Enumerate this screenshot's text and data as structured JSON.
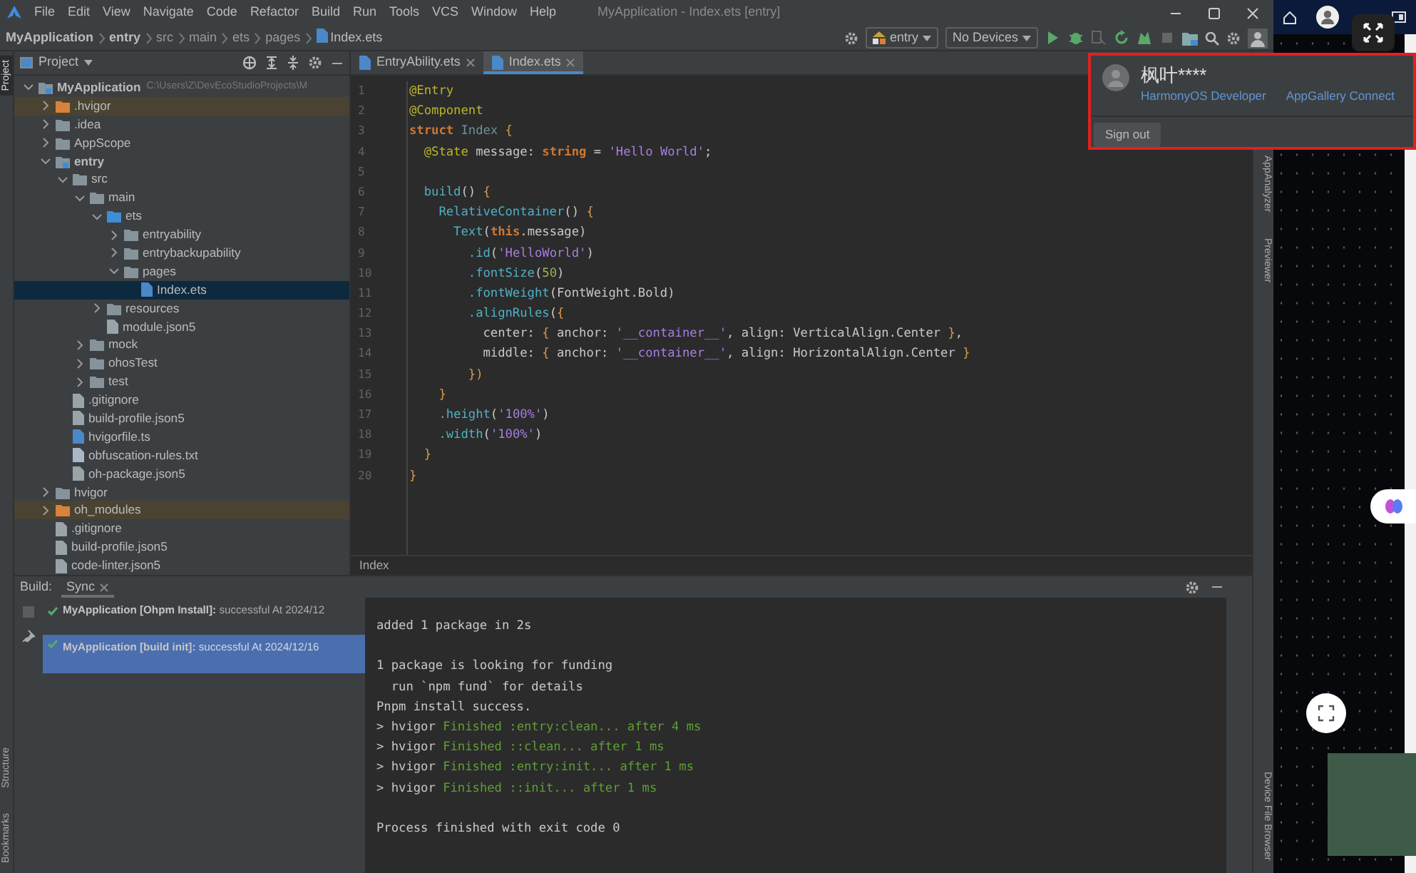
{
  "window": {
    "title": "MyApplication - Index.ets [entry]"
  },
  "menu": [
    "File",
    "Edit",
    "View",
    "Navigate",
    "Code",
    "Refactor",
    "Build",
    "Run",
    "Tools",
    "VCS",
    "Window",
    "Help"
  ],
  "breadcrumb": [
    {
      "kind": "project",
      "label": "MyApplication"
    },
    {
      "kind": "module",
      "label": "entry"
    },
    {
      "kind": "folder",
      "label": "src"
    },
    {
      "kind": "folder",
      "label": "main"
    },
    {
      "kind": "folder",
      "label": "ets"
    },
    {
      "kind": "folder",
      "label": "pages"
    },
    {
      "kind": "file",
      "label": "Index.ets"
    }
  ],
  "toolbar": {
    "configuration": "entry",
    "device": "No Devices",
    "actions": [
      {
        "kind": "run",
        "disabled": false
      },
      {
        "kind": "debug",
        "disabled": false
      },
      {
        "kind": "attach",
        "disabled": true
      },
      {
        "kind": "rerun",
        "disabled": false
      },
      {
        "kind": "profile",
        "disabled": false
      },
      {
        "kind": "stop",
        "disabled": true
      }
    ]
  },
  "tool_windows": {
    "left_top": [
      {
        "label": "Project",
        "selected": true
      }
    ],
    "left_bottom": [
      {
        "label": "Structure",
        "selected": false
      },
      {
        "label": "Bookmarks",
        "selected": false
      }
    ],
    "right_top": [
      {
        "label": "AppAnalyzer",
        "selected": false
      },
      {
        "label": "Previewer",
        "selected": false
      }
    ],
    "right_bottom": [
      {
        "label": "Device File Browser",
        "selected": false
      }
    ]
  },
  "project_panel": {
    "title": "Project",
    "tree": [
      {
        "kind": "module",
        "label": "MyApplication",
        "path": "C:\\Users\\Z\\DevEcoStudioProjects\\M",
        "expanded": true,
        "selected": false,
        "children": [
          {
            "kind": "excluded-folder",
            "label": ".hvigor",
            "expanded": false,
            "selected": false
          },
          {
            "kind": "folder",
            "label": ".idea",
            "expanded": false,
            "selected": false
          },
          {
            "kind": "folder",
            "label": "AppScope",
            "expanded": false,
            "selected": false
          },
          {
            "kind": "module",
            "label": "entry",
            "expanded": true,
            "selected": false,
            "children": [
              {
                "kind": "folder",
                "label": "src",
                "expanded": true,
                "selected": false,
                "children": [
                  {
                    "kind": "folder",
                    "label": "main",
                    "expanded": true,
                    "selected": false,
                    "children": [
                      {
                        "kind": "source-folder",
                        "label": "ets",
                        "expanded": true,
                        "selected": false,
                        "children": [
                          {
                            "kind": "folder",
                            "label": "entryability",
                            "expanded": false,
                            "selected": false
                          },
                          {
                            "kind": "folder",
                            "label": "entrybackupability",
                            "expanded": false,
                            "selected": false
                          },
                          {
                            "kind": "folder",
                            "label": "pages",
                            "expanded": true,
                            "selected": false,
                            "children": [
                              {
                                "kind": "code-file",
                                "label": "Index.ets",
                                "selected": true
                              }
                            ]
                          }
                        ]
                      },
                      {
                        "kind": "folder",
                        "label": "resources",
                        "expanded": false,
                        "selected": false
                      },
                      {
                        "kind": "config-file",
                        "label": "module.json5",
                        "selected": false
                      }
                    ]
                  },
                  {
                    "kind": "folder",
                    "label": "mock",
                    "expanded": false,
                    "selected": false
                  },
                  {
                    "kind": "folder",
                    "label": "ohosTest",
                    "expanded": false,
                    "selected": false
                  },
                  {
                    "kind": "folder",
                    "label": "test",
                    "expanded": false,
                    "selected": false
                  }
                ]
              },
              {
                "kind": "config-file",
                "label": ".gitignore",
                "selected": false
              },
              {
                "kind": "config-file",
                "label": "build-profile.json5",
                "selected": false
              },
              {
                "kind": "code-file",
                "label": "hvigorfile.ts",
                "selected": false
              },
              {
                "kind": "text-file",
                "label": "obfuscation-rules.txt",
                "selected": false
              },
              {
                "kind": "config-file",
                "label": "oh-package.json5",
                "selected": false
              }
            ]
          },
          {
            "kind": "folder",
            "label": "hvigor",
            "expanded": false,
            "selected": false
          },
          {
            "kind": "excluded-folder",
            "label": "oh_modules",
            "expanded": false,
            "selected": false
          },
          {
            "kind": "config-file",
            "label": ".gitignore",
            "selected": false
          },
          {
            "kind": "config-file",
            "label": "build-profile.json5",
            "selected": false
          },
          {
            "kind": "config-file",
            "label": "code-linter.json5",
            "selected": false
          }
        ]
      }
    ]
  },
  "editor": {
    "tabs": [
      {
        "label": "EntryAbility.ets",
        "selected": false
      },
      {
        "label": "Index.ets",
        "selected": true
      }
    ],
    "lines": [
      {
        "number": "1",
        "tokens": [
          {
            "kind": "decorator",
            "text": "@Entry"
          }
        ]
      },
      {
        "number": "2",
        "tokens": [
          {
            "kind": "decorator",
            "text": "@Component"
          }
        ]
      },
      {
        "number": "3",
        "tokens": [
          {
            "kind": "keyword",
            "text": "struct"
          },
          {
            "kind": "type",
            "text": " Index"
          },
          {
            "kind": "brace",
            "text": " {"
          }
        ]
      },
      {
        "number": "4",
        "tokens": [
          {
            "kind": "decorator",
            "text": "  @State"
          },
          {
            "kind": "plain",
            "text": " message: "
          },
          {
            "kind": "keyword",
            "text": "string"
          },
          {
            "kind": "plain",
            "text": " = "
          },
          {
            "kind": "string",
            "text": "'Hello World'"
          },
          {
            "kind": "plain",
            "text": ";"
          }
        ]
      },
      {
        "number": "5"
      },
      {
        "number": "6",
        "tokens": [
          {
            "kind": "func",
            "text": "  build"
          },
          {
            "kind": "plain",
            "text": "() "
          },
          {
            "kind": "brace",
            "text": "{"
          }
        ]
      },
      {
        "number": "7",
        "tokens": [
          {
            "kind": "func",
            "text": "    RelativeContainer"
          },
          {
            "kind": "plain",
            "text": "() "
          },
          {
            "kind": "brace",
            "text": "{"
          }
        ]
      },
      {
        "number": "8",
        "tokens": [
          {
            "kind": "func",
            "text": "      Text"
          },
          {
            "kind": "plain",
            "text": "("
          },
          {
            "kind": "keyword",
            "text": "this"
          },
          {
            "kind": "plain",
            "text": ".message)"
          }
        ]
      },
      {
        "number": "9",
        "tokens": [
          {
            "kind": "func",
            "text": "        .id"
          },
          {
            "kind": "plain",
            "text": "("
          },
          {
            "kind": "string",
            "text": "'HelloWorld'"
          },
          {
            "kind": "plain",
            "text": ")"
          }
        ]
      },
      {
        "number": "10",
        "tokens": [
          {
            "kind": "func",
            "text": "        .fontSize"
          },
          {
            "kind": "plain",
            "text": "("
          },
          {
            "kind": "number",
            "text": "50"
          },
          {
            "kind": "plain",
            "text": ")"
          }
        ]
      },
      {
        "number": "11",
        "tokens": [
          {
            "kind": "func",
            "text": "        .fontWeight"
          },
          {
            "kind": "plain",
            "text": "(FontWeight.Bold)"
          }
        ]
      },
      {
        "number": "12",
        "tokens": [
          {
            "kind": "func",
            "text": "        .alignRules"
          },
          {
            "kind": "plain",
            "text": "("
          },
          {
            "kind": "brace",
            "text": "{"
          }
        ]
      },
      {
        "number": "13",
        "tokens": [
          {
            "kind": "plain",
            "text": "          center: "
          },
          {
            "kind": "brace",
            "text": "{"
          },
          {
            "kind": "plain",
            "text": " anchor: "
          },
          {
            "kind": "string",
            "text": "'__container__'"
          },
          {
            "kind": "plain",
            "text": ", align: VerticalAlign.Center "
          },
          {
            "kind": "brace",
            "text": "}"
          },
          {
            "kind": "plain",
            "text": ","
          }
        ]
      },
      {
        "number": "14",
        "tokens": [
          {
            "kind": "plain",
            "text": "          middle: "
          },
          {
            "kind": "brace",
            "text": "{"
          },
          {
            "kind": "plain",
            "text": " anchor: "
          },
          {
            "kind": "string",
            "text": "'__container__'"
          },
          {
            "kind": "plain",
            "text": ", align: HorizontalAlign.Center "
          },
          {
            "kind": "brace",
            "text": "}"
          }
        ]
      },
      {
        "number": "15",
        "tokens": [
          {
            "kind": "brace",
            "text": "        })"
          }
        ]
      },
      {
        "number": "16",
        "tokens": [
          {
            "kind": "brace",
            "text": "    }"
          }
        ]
      },
      {
        "number": "17",
        "tokens": [
          {
            "kind": "func",
            "text": "    .height"
          },
          {
            "kind": "plain",
            "text": "("
          },
          {
            "kind": "string",
            "text": "'100%'"
          },
          {
            "kind": "plain",
            "text": ")"
          }
        ]
      },
      {
        "number": "18",
        "tokens": [
          {
            "kind": "func",
            "text": "    .width"
          },
          {
            "kind": "plain",
            "text": "("
          },
          {
            "kind": "string",
            "text": "'100%'"
          },
          {
            "kind": "plain",
            "text": ")"
          }
        ]
      },
      {
        "number": "19",
        "tokens": [
          {
            "kind": "brace",
            "text": "  }"
          }
        ]
      },
      {
        "number": "20",
        "tokens": [
          {
            "kind": "brace",
            "text": "}"
          }
        ]
      }
    ],
    "breadcrumb": "Index"
  },
  "build_panel": {
    "title": "Build:",
    "tabs": [
      {
        "label": "Sync",
        "selected": true
      }
    ],
    "tasks": [
      {
        "text": "**MyApplication [Ohpm Install]:** successful At 2024/12",
        "selected": false
      },
      {
        "text": "**MyApplication [build init]:** successful At 2024/12/16",
        "selected": true
      }
    ],
    "console": [
      {
        "tokens": [
          {
            "kind": "plain",
            "text": "added 1 package in 2s"
          }
        ]
      },
      {
        "spaced": true,
        "tokens": [
          {
            "kind": "plain",
            "text": "1 package is looking for funding"
          }
        ]
      },
      {
        "tokens": [
          {
            "kind": "plain",
            "text": "  run `npm fund` for details"
          }
        ]
      },
      {
        "tokens": [
          {
            "kind": "plain",
            "text": "Pnpm install success."
          }
        ]
      },
      {
        "tokens": [
          {
            "kind": "plain",
            "text": "> hvigor "
          },
          {
            "kind": "success",
            "text": "Finished :entry:clean... after 4 ms"
          }
        ]
      },
      {
        "tokens": [
          {
            "kind": "plain",
            "text": "> hvigor "
          },
          {
            "kind": "success",
            "text": "Finished ::clean... after 1 ms"
          }
        ]
      },
      {
        "tokens": [
          {
            "kind": "plain",
            "text": "> hvigor "
          },
          {
            "kind": "success",
            "text": "Finished :entry:init... after 1 ms"
          }
        ]
      },
      {
        "tokens": [
          {
            "kind": "plain",
            "text": "> hvigor "
          },
          {
            "kind": "success",
            "text": "Finished ::init... after 1 ms"
          }
        ]
      },
      {
        "spaced": true,
        "tokens": [
          {
            "kind": "plain",
            "text": "Process finished with exit code 0"
          }
        ]
      }
    ]
  },
  "account_popup": {
    "name": "枫叶****",
    "links": [
      "HarmonyOS Developer",
      "AppGallery Connect"
    ],
    "button": "Sign out"
  }
}
